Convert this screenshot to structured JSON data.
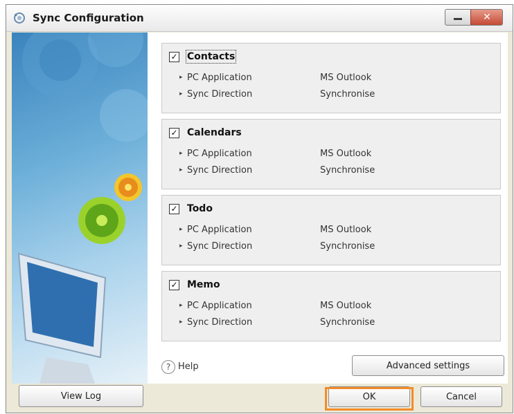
{
  "window": {
    "title": "Sync Configuration",
    "close_glyph": "✕"
  },
  "groups": [
    {
      "name": "Contacts",
      "checked": true,
      "rows": [
        {
          "label": "PC Application",
          "value": "MS Outlook"
        },
        {
          "label": "Sync Direction",
          "value": "Synchronise"
        }
      ]
    },
    {
      "name": "Calendars",
      "checked": true,
      "rows": [
        {
          "label": "PC Application",
          "value": "MS Outlook"
        },
        {
          "label": "Sync Direction",
          "value": "Synchronise"
        }
      ]
    },
    {
      "name": "Todo",
      "checked": true,
      "rows": [
        {
          "label": "PC Application",
          "value": "MS Outlook"
        },
        {
          "label": "Sync Direction",
          "value": "Synchronise"
        }
      ]
    },
    {
      "name": "Memo",
      "checked": true,
      "rows": [
        {
          "label": "PC Application",
          "value": "MS Outlook"
        },
        {
          "label": "Sync Direction",
          "value": "Synchronise"
        }
      ]
    }
  ],
  "check_glyph": "✓",
  "help": {
    "icon": "?",
    "label": "Help"
  },
  "buttons": {
    "advanced": "Advanced settings",
    "view_log": "View Log",
    "ok": "OK",
    "cancel": "Cancel"
  },
  "colors": {
    "highlight": "#f28c28",
    "panel_blue": "#3b83bd"
  }
}
